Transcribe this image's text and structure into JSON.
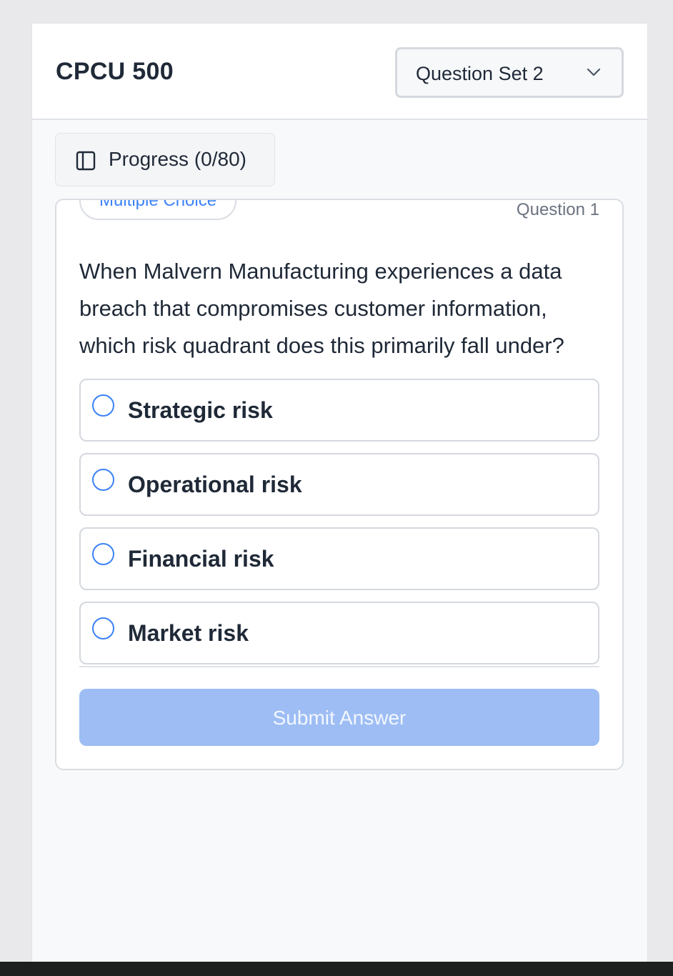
{
  "header": {
    "title": "CPCU 500",
    "question_set": {
      "selected": "Question Set 2",
      "icon": "chevron-down-icon"
    }
  },
  "progress": {
    "label": "Progress (0/80)",
    "icon": "sidebar-panel-icon",
    "answered": 0,
    "total": 80
  },
  "question_card": {
    "type_badge": "Multiple Choice",
    "number_label": "Question 1",
    "text": "When Malvern Manufacturing experiences a data breach that compromises customer information, which risk quadrant does this primarily fall under?",
    "options": [
      {
        "label": "Strategic risk",
        "selected": false
      },
      {
        "label": "Operational risk",
        "selected": false
      },
      {
        "label": "Financial risk",
        "selected": false
      },
      {
        "label": "Market risk",
        "selected": false
      }
    ],
    "submit_label": "Submit Answer",
    "submit_enabled": false
  },
  "colors": {
    "accent": "#3b82f6",
    "submit_disabled_bg": "#9dbdf4",
    "background": "#f8f9fb"
  }
}
